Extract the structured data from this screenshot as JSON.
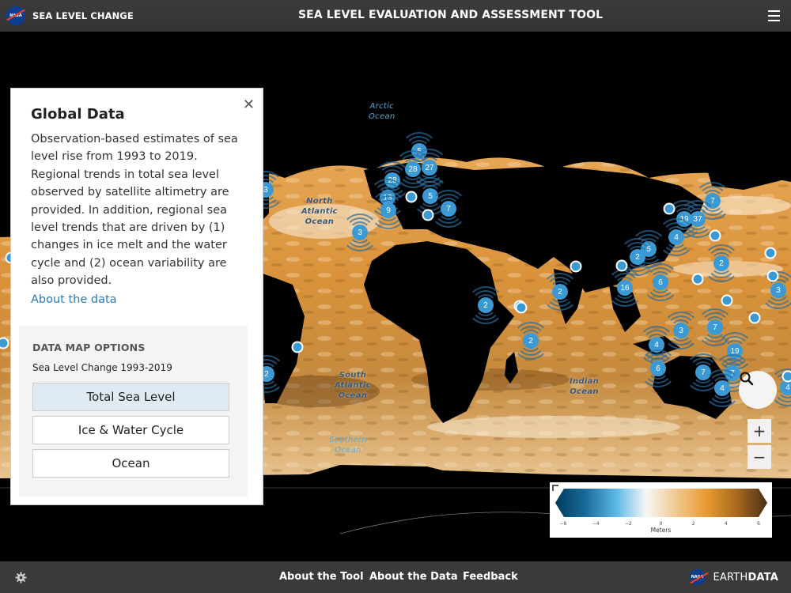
{
  "header": {
    "logo_text": "NASA",
    "brand": "SEA LEVEL CHANGE",
    "title": "SEA LEVEL EVALUATION AND ASSESSMENT TOOL",
    "menu_icon": "hamburger-menu-icon"
  },
  "map": {
    "ocean_labels": [
      {
        "id": "arctic",
        "lines": [
          "Arctic",
          "Ocean"
        ]
      },
      {
        "id": "north-atlantic",
        "lines": [
          "North",
          "Atlantic",
          "Ocean"
        ]
      },
      {
        "id": "south-atlantic",
        "lines": [
          "South",
          "Atlantic",
          "Ocean"
        ]
      },
      {
        "id": "indian",
        "lines": [
          "Indian",
          "Ocean"
        ]
      },
      {
        "id": "southern",
        "lines": [
          "Southern",
          "Ocean"
        ]
      }
    ],
    "clusters": [
      {
        "count": "3",
        "region": "us-east-coast"
      },
      {
        "count": "5",
        "region": "baltic"
      },
      {
        "count": "28",
        "region": "north-sea-east"
      },
      {
        "count": "27",
        "region": "baltic-east"
      },
      {
        "count": "28",
        "region": "uk"
      },
      {
        "count": "13",
        "region": "france-west"
      },
      {
        "count": "9",
        "region": "iberia"
      },
      {
        "count": "5",
        "region": "adriatic"
      },
      {
        "count": "7",
        "region": "eastern-med"
      },
      {
        "count": "3",
        "region": "canary"
      },
      {
        "count": "2",
        "region": "brazil-south"
      },
      {
        "count": "2",
        "region": "east-africa"
      },
      {
        "count": "2",
        "region": "madagascar-east"
      },
      {
        "count": "2",
        "region": "arabian-sea"
      },
      {
        "count": "7",
        "region": "japan-north"
      },
      {
        "count": "19",
        "region": "japan-korea"
      },
      {
        "count": "37",
        "region": "japan"
      },
      {
        "count": "4",
        "region": "taiwan"
      },
      {
        "count": "5",
        "region": "hong-kong"
      },
      {
        "count": "2",
        "region": "vietnam"
      },
      {
        "count": "16",
        "region": "malaysia"
      },
      {
        "count": "6",
        "region": "borneo"
      },
      {
        "count": "2",
        "region": "pacific-north"
      },
      {
        "count": "3",
        "region": "pacific-islands"
      },
      {
        "count": "3",
        "region": "australia-north"
      },
      {
        "count": "7",
        "region": "australia-northeast"
      },
      {
        "count": "4",
        "region": "australia-west-north"
      },
      {
        "count": "19",
        "region": "australia-east"
      },
      {
        "count": "6",
        "region": "australia-west"
      },
      {
        "count": "7",
        "region": "australia-south"
      },
      {
        "count": "7",
        "region": "australia-southeast"
      },
      {
        "count": "4",
        "region": "tasmania"
      },
      {
        "count": "4",
        "region": "new-zealand"
      }
    ],
    "pins": 17
  },
  "panel": {
    "title": "Global Data",
    "close_icon": "close-icon",
    "description": "Observation-based estimates of sea level rise from 1993 to 2019. Regional trends in total sea level observed by satellite altimetry are provided. In addition, regional sea level trends that are driven by (1) changes in ice melt and the water cycle and (2) ocean variability are also provided.",
    "link": "About the data",
    "options": {
      "heading": "DATA MAP OPTIONS",
      "subheading": "Sea Level Change 1993-2019",
      "buttons": [
        {
          "label": "Total Sea Level",
          "active": true
        },
        {
          "label": "Ice & Water Cycle",
          "active": false
        },
        {
          "label": "Ocean",
          "active": false
        }
      ]
    }
  },
  "controls": {
    "search_icon": "search-icon",
    "zoom_in": "+",
    "zoom_out": "−"
  },
  "legend": {
    "ticks": [
      "−6",
      "−4",
      "−2",
      "0",
      "2",
      "4",
      "6"
    ],
    "range": [
      -6,
      6
    ],
    "unit": "Meters",
    "colors": [
      "#003a5c",
      "#1a6a9a",
      "#5bb8e6",
      "#f7f7f7",
      "#f0c890",
      "#e89a30",
      "#a8681f",
      "#4a3018"
    ]
  },
  "footer": {
    "settings_icon": "gear-icon",
    "links": [
      "About the Tool",
      "About the Data",
      "Feedback"
    ],
    "earthdata_prefix": "EARTH",
    "earthdata_bold": "DATA"
  }
}
